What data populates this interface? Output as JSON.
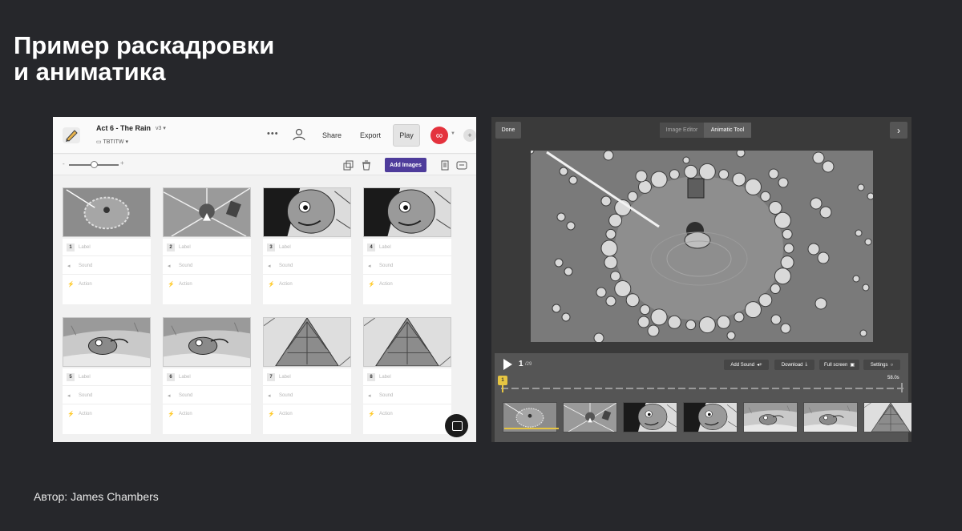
{
  "slide": {
    "title_line1": "Пример раскадровки",
    "title_line2": "и аниматика",
    "author": "Автор: James Chambers"
  },
  "storyboard": {
    "project_title": "Act 6 - The Rain",
    "version": "v3",
    "folder": "TBTITW",
    "buttons": {
      "more": "•••",
      "share": "Share",
      "export": "Export",
      "play": "Play",
      "add_images": "Add Images"
    },
    "avatar_glyph": "∞",
    "zoom": {
      "minus": "-",
      "plus": "+",
      "level": 0.5
    },
    "row_labels": {
      "label": "Label",
      "sound": "Sound",
      "action": "Action"
    },
    "panels": [
      {
        "num": "1",
        "scene": "rain-circle"
      },
      {
        "num": "2",
        "scene": "burst"
      },
      {
        "num": "3",
        "scene": "face"
      },
      {
        "num": "4",
        "scene": "face"
      },
      {
        "num": "5",
        "scene": "creature"
      },
      {
        "num": "6",
        "scene": "creature"
      },
      {
        "num": "7",
        "scene": "tree"
      },
      {
        "num": "8",
        "scene": "tree"
      }
    ],
    "colors": {
      "accent": "#4e3c9b",
      "avatar": "#e4323d"
    }
  },
  "animatic": {
    "done": "Done",
    "tabs": [
      "Image Editor",
      "Animatic Tool"
    ],
    "active_tab": "Animatic Tool",
    "frame_current": "1",
    "frame_total": "/29",
    "buttons": {
      "add_sound": "Add Sound",
      "download": "Download",
      "full_screen": "Full screen",
      "settings": "Settings"
    },
    "duration": "58.0s",
    "marker": "1",
    "strip_scenes": [
      "rain-circle",
      "burst",
      "face",
      "face",
      "creature",
      "creature",
      "tree"
    ],
    "colors": {
      "marker": "#e6c542"
    }
  }
}
